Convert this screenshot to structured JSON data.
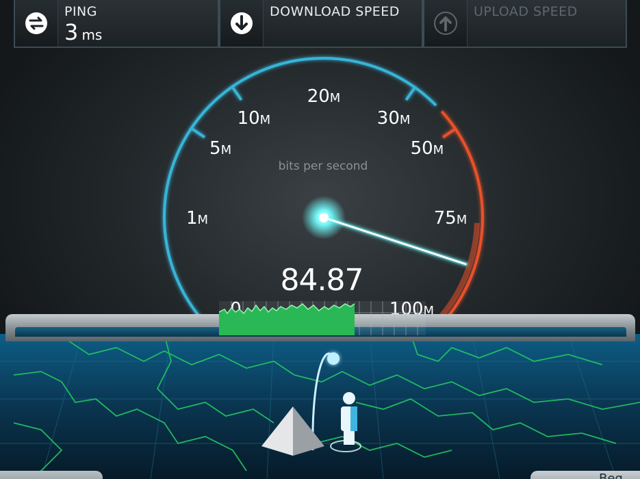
{
  "header": {
    "ping": {
      "label": "PING",
      "value": "3",
      "unit": "ms",
      "icon": "ping-arrows-icon"
    },
    "download": {
      "label": "DOWNLOAD SPEED",
      "icon": "download-arrow-icon"
    },
    "upload": {
      "label": "UPLOAD SPEED",
      "icon": "upload-arrow-icon"
    }
  },
  "gauge": {
    "unit_label": "bits per second",
    "current_value": "84.87",
    "scale_labels": [
      {
        "num": "0",
        "suffix": ""
      },
      {
        "num": "1",
        "suffix": "M"
      },
      {
        "num": "5",
        "suffix": "M"
      },
      {
        "num": "10",
        "suffix": "M"
      },
      {
        "num": "20",
        "suffix": "M"
      },
      {
        "num": "30",
        "suffix": "M"
      },
      {
        "num": "50",
        "suffix": "M"
      },
      {
        "num": "75",
        "suffix": "M"
      },
      {
        "num": "100",
        "suffix": "M"
      }
    ],
    "colors": {
      "normal": "#38b4d8",
      "high": "#e8512a",
      "needle": "#5df2f0"
    }
  },
  "bottom": {
    "button_partial": "Beg"
  }
}
